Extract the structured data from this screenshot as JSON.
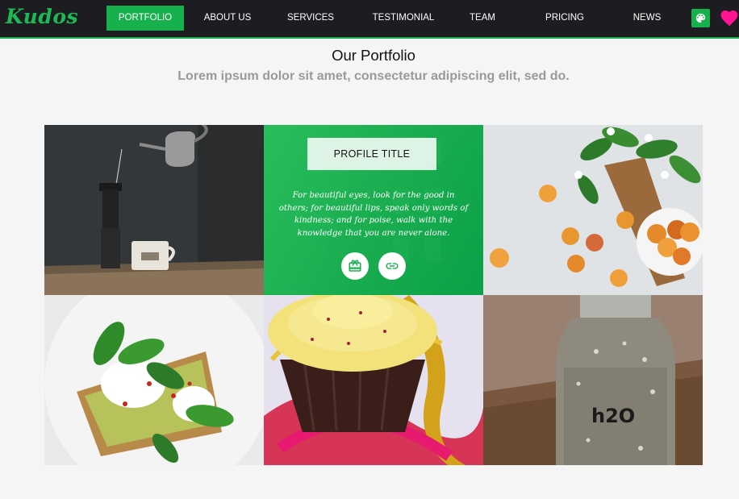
{
  "brand": {
    "logo": "Kudos"
  },
  "nav": {
    "items": [
      {
        "label": "PORTFOLIO",
        "active": true
      },
      {
        "label": "ABOUT US",
        "active": false
      },
      {
        "label": "SERVICES",
        "active": false
      },
      {
        "label": "TESTIMONIAL",
        "active": false
      },
      {
        "label": "TEAM",
        "active": false
      },
      {
        "label": "PRICING",
        "active": false
      },
      {
        "label": "NEWS",
        "active": false
      }
    ],
    "icons": [
      "palette-icon",
      "heart-icon"
    ]
  },
  "section": {
    "title": "Our Portfolio",
    "subtitle": "Lorem ipsum dolor sit amet, consectetur adipiscing elit, sed do."
  },
  "portfolio": {
    "overlay": {
      "title": "PROFILE TITLE",
      "quote": "For beautiful eyes, look for the good in others; for beautiful lips, speak only words of kindness; and for poise, walk with the knowledge that you are never alone.",
      "buttons": [
        "gift-icon",
        "link-icon"
      ]
    },
    "images": [
      {
        "subject": "coffee-pour"
      },
      {
        "subject": "green-building"
      },
      {
        "subject": "apricots"
      },
      {
        "subject": "avocado-toast"
      },
      {
        "subject": "cupcake"
      },
      {
        "subject": "water-bottle"
      }
    ],
    "bottle_label": "h2O"
  },
  "colors": {
    "accent": "#16b14c",
    "navbar": "#1d1c20",
    "heart": "#ff1493"
  }
}
